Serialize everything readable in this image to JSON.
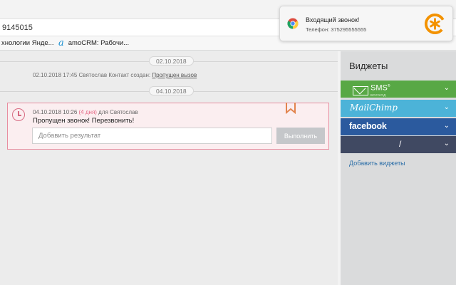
{
  "browser": {
    "url_fragment": "9145015",
    "bookmarks": [
      {
        "label": "хнологии Янде..."
      },
      {
        "icon": "a",
        "label": "amoCRM: Рабочи..."
      }
    ]
  },
  "feed": {
    "dates": [
      "02.10.2018",
      "04.10.2018"
    ],
    "event": {
      "text": "02.10.2018 17:45 Святослав   Контакт создан:",
      "link": "Пропущен вызов"
    },
    "task": {
      "datetime": "04.10.2018 10:26",
      "days": "(4 дня)",
      "assignee": "для Святослав",
      "text": "Пропущен звонок! Перезвонить!",
      "input_placeholder": "Добавить результат",
      "button_label": "Выполнить"
    }
  },
  "widgets": {
    "title": "Виджеты",
    "items": [
      {
        "name": "SMS",
        "subtitle": "ВОСХОД",
        "color": "#58a845"
      },
      {
        "name": "MailChimp",
        "color": "#4cb3d8"
      },
      {
        "name": "facebook",
        "color": "#2b5a9e"
      },
      {
        "name": "/",
        "color": "#404962"
      }
    ],
    "chevron": "⌄",
    "add_link": "Добавить виджеты"
  },
  "notification": {
    "title": "Входящий звонок!",
    "body": "Телефон: 375295555555"
  },
  "colors": {
    "task_border": "#e88ea0",
    "task_bg": "#fbeef0",
    "accent_pink": "#e56784",
    "link_blue": "#2d6fa8"
  }
}
